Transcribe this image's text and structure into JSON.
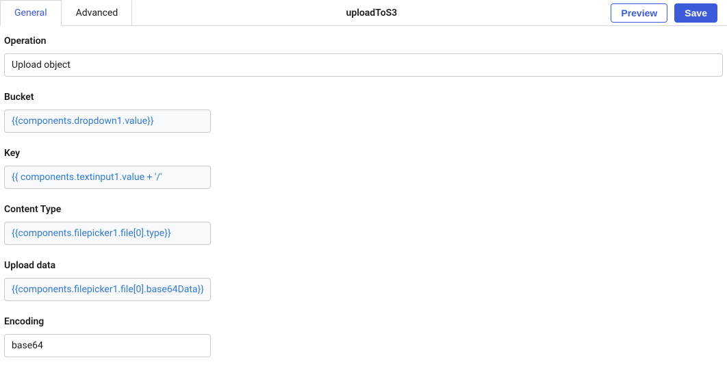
{
  "header": {
    "tabs": {
      "general": "General",
      "advanced": "Advanced"
    },
    "title": "uploadToS3",
    "preview_label": "Preview",
    "save_label": "Save"
  },
  "fields": {
    "operation": {
      "label": "Operation",
      "value": "Upload object"
    },
    "bucket": {
      "label": "Bucket",
      "value": "{{components.dropdown1.value}}"
    },
    "key": {
      "label": "Key",
      "value": "{{ components.textinput1.value + '/'"
    },
    "contentType": {
      "label": "Content Type",
      "value": "{{components.filepicker1.file[0].type}}"
    },
    "uploadData": {
      "label": "Upload data",
      "value": "{{components.filepicker1.file[0].base64Data}}"
    },
    "encoding": {
      "label": "Encoding",
      "value": "base64"
    }
  }
}
